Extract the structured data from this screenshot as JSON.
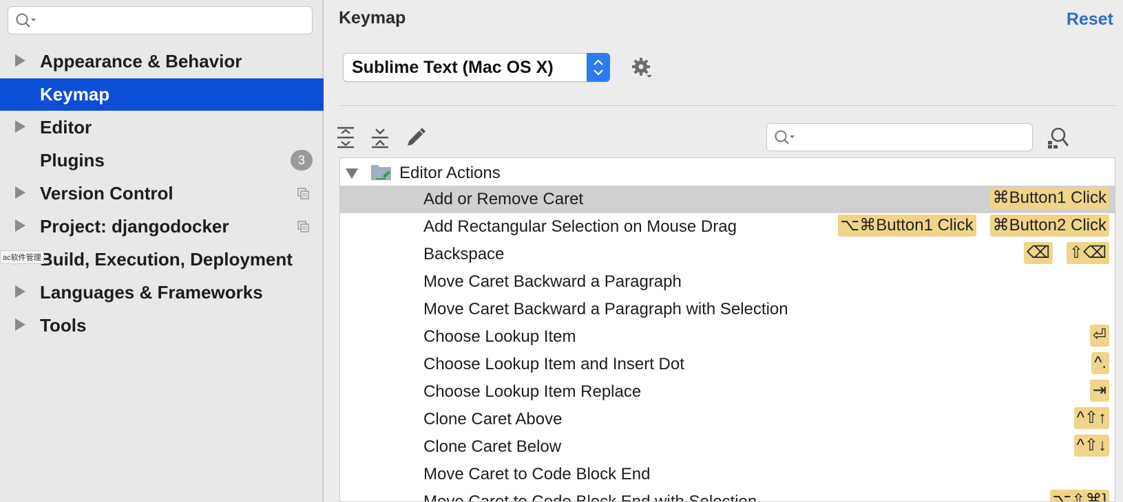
{
  "sidebar": {
    "search_placeholder": "",
    "items": [
      {
        "label": "Appearance & Behavior",
        "expandable": true
      },
      {
        "label": "Keymap",
        "expandable": false,
        "selected": true
      },
      {
        "label": "Editor",
        "expandable": true
      },
      {
        "label": "Plugins",
        "expandable": false,
        "badge": "3"
      },
      {
        "label": "Version Control",
        "expandable": true
      },
      {
        "label": "Project: djangodocker",
        "expandable": true
      },
      {
        "label": "Build, Execution, Deployment",
        "expandable": true
      },
      {
        "label": "Languages & Frameworks",
        "expandable": true
      },
      {
        "label": "Tools",
        "expandable": true
      }
    ],
    "watermark_tag": "ac软件管理"
  },
  "main": {
    "title": "Keymap",
    "reset_label": "Reset",
    "scheme_value": "Sublime Text (Mac OS X)",
    "group_label": "Editor Actions",
    "actions": [
      {
        "name": "Add or Remove Caret",
        "shortcuts": [
          "⌘Button1 Click"
        ]
      },
      {
        "name": "Add Rectangular Selection on Mouse Drag",
        "shortcuts": [
          "⌥⌘Button1 Click",
          "⌘Button2 Click"
        ]
      },
      {
        "name": "Backspace",
        "shortcuts": [
          "⌫",
          "⇧⌫"
        ]
      },
      {
        "name": "Move Caret Backward a Paragraph",
        "shortcuts": []
      },
      {
        "name": "Move Caret Backward a Paragraph with Selection",
        "shortcuts": []
      },
      {
        "name": "Choose Lookup Item",
        "shortcuts": [
          "⏎"
        ]
      },
      {
        "name": "Choose Lookup Item and Insert Dot",
        "shortcuts": [
          "^."
        ]
      },
      {
        "name": "Choose Lookup Item Replace",
        "shortcuts": [
          "⇥"
        ]
      },
      {
        "name": "Clone Caret Above",
        "shortcuts": [
          "^⇧↑"
        ]
      },
      {
        "name": "Clone Caret Below",
        "shortcuts": [
          "^⇧↓"
        ]
      },
      {
        "name": "Move Caret to Code Block End",
        "shortcuts": []
      },
      {
        "name": "Move Caret to Code Block End with Selection",
        "shortcuts": [
          "⌥⇧⌘]"
        ]
      }
    ]
  },
  "colors": {
    "accent": "#0b4fd6",
    "link": "#2a6fc9",
    "shortcut_bg": "#efd48a"
  }
}
